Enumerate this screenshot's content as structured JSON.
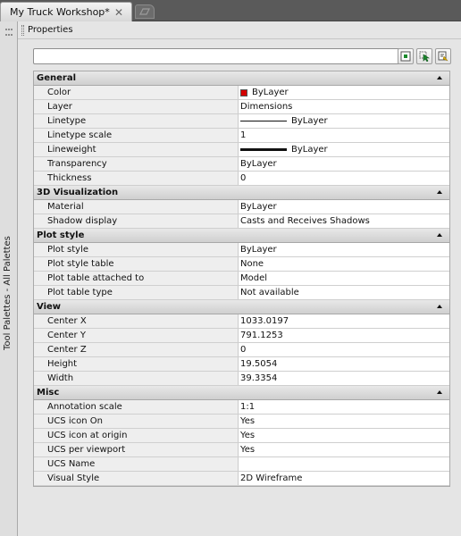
{
  "document_tab": {
    "title": "My Truck Workshop*",
    "close_glyph": "✕"
  },
  "toolstrip": {
    "label": "Tool Palettes - All Palettes"
  },
  "palette": {
    "title": "Properties"
  },
  "selector": {
    "value": ""
  },
  "toolbar": {
    "icons": [
      "toggle-pickadd-icon",
      "select-objects-icon",
      "quick-select-icon"
    ]
  },
  "colors": {
    "color_swatch": "#d40000",
    "panel_bg": "#e5e5e5",
    "section_bg": "#d8d8d8"
  },
  "sections": [
    {
      "title": "General",
      "rows": [
        {
          "name": "Color",
          "value": "ByLayer",
          "kind": "color"
        },
        {
          "name": "Layer",
          "value": "Dimensions"
        },
        {
          "name": "Linetype",
          "value": "ByLayer",
          "kind": "linetype"
        },
        {
          "name": "Linetype scale",
          "value": "1"
        },
        {
          "name": "Lineweight",
          "value": "ByLayer",
          "kind": "lineweight"
        },
        {
          "name": "Transparency",
          "value": "ByLayer"
        },
        {
          "name": "Thickness",
          "value": "0"
        }
      ]
    },
    {
      "title": "3D Visualization",
      "rows": [
        {
          "name": "Material",
          "value": "ByLayer"
        },
        {
          "name": "Shadow display",
          "value": "Casts and Receives Shadows"
        }
      ]
    },
    {
      "title": "Plot style",
      "rows": [
        {
          "name": "Plot style",
          "value": "ByLayer"
        },
        {
          "name": "Plot style table",
          "value": "None"
        },
        {
          "name": "Plot table attached to",
          "value": "Model"
        },
        {
          "name": "Plot table type",
          "value": "Not available"
        }
      ]
    },
    {
      "title": "View",
      "rows": [
        {
          "name": "Center X",
          "value": "1033.0197"
        },
        {
          "name": "Center Y",
          "value": "791.1253"
        },
        {
          "name": "Center Z",
          "value": "0"
        },
        {
          "name": "Height",
          "value": "19.5054"
        },
        {
          "name": "Width",
          "value": "39.3354"
        }
      ]
    },
    {
      "title": "Misc",
      "rows": [
        {
          "name": "Annotation scale",
          "value": "1:1"
        },
        {
          "name": "UCS icon On",
          "value": "Yes"
        },
        {
          "name": "UCS icon at origin",
          "value": "Yes"
        },
        {
          "name": "UCS per viewport",
          "value": "Yes"
        },
        {
          "name": "UCS Name",
          "value": ""
        },
        {
          "name": "Visual Style",
          "value": "2D Wireframe"
        }
      ]
    }
  ]
}
